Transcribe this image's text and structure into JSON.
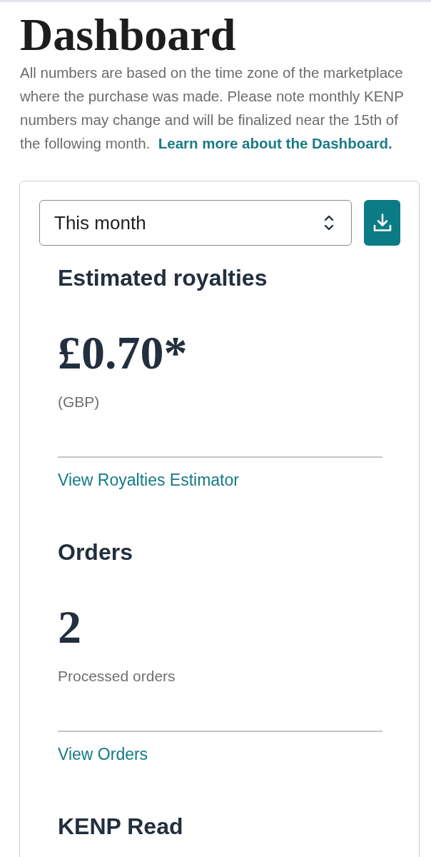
{
  "page": {
    "title": "Dashboard",
    "intro": "All numbers are based on the time zone of the marketplace where the purchase was made. Please note monthly KENP numbers may change and will be finalized near the 15th of the following month.",
    "intro_link": "Learn more about the Dashboard."
  },
  "card": {
    "period_select": {
      "value": "This month"
    },
    "sections": [
      {
        "heading": "Estimated royalties",
        "value": "£0.70*",
        "caption": "(GBP)",
        "link": "View Royalties Estimator"
      },
      {
        "heading": "Orders",
        "value": "2",
        "caption": "Processed orders",
        "link": "View Orders"
      },
      {
        "heading": "KENP Read"
      }
    ]
  }
}
